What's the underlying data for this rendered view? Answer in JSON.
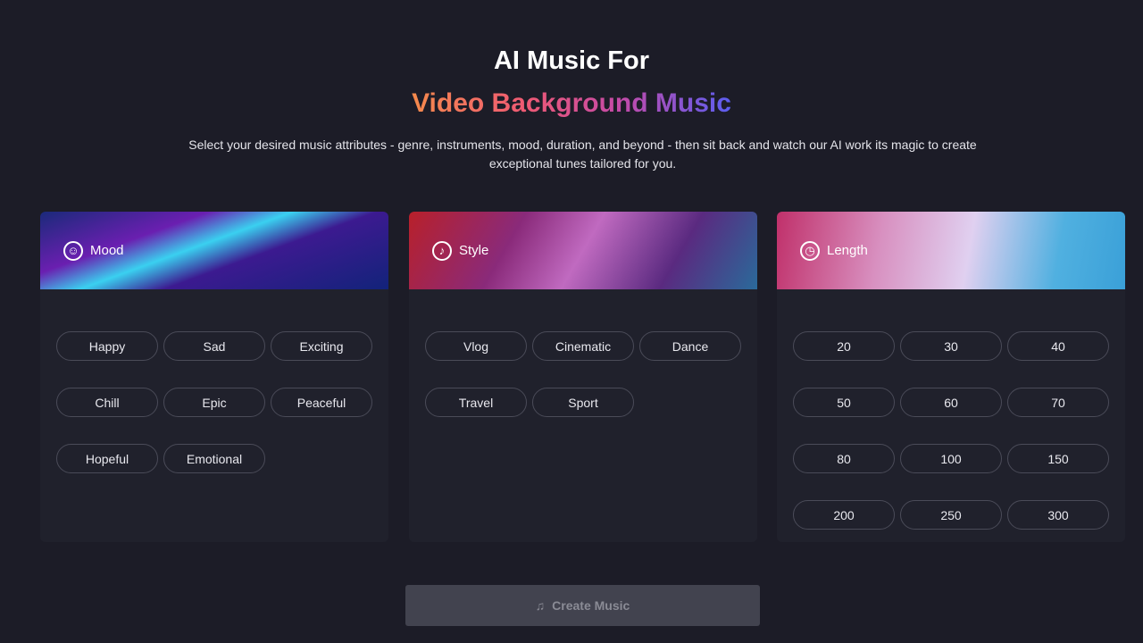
{
  "header": {
    "title": "AI Music For",
    "subtitle": "Video Background Music",
    "description": "Select your desired music attributes - genre, instruments, mood, duration, and beyond - then sit back and watch our AI work its magic to create exceptional tunes tailored for you."
  },
  "cards": [
    {
      "title": "Mood",
      "icon": "mood-faces-icon",
      "options": [
        "Happy",
        "Sad",
        "Exciting",
        "Chill",
        "Epic",
        "Peaceful",
        "Hopeful",
        "Emotional"
      ]
    },
    {
      "title": "Style",
      "icon": "music-note-icon",
      "options": [
        "Vlog",
        "Cinematic",
        "Dance",
        "Travel",
        "Sport"
      ]
    },
    {
      "title": "Length",
      "icon": "clock-icon",
      "options": [
        "20",
        "30",
        "40",
        "50",
        "60",
        "70",
        "80",
        "100",
        "150",
        "200",
        "250",
        "300"
      ]
    }
  ],
  "create_button": {
    "label": "Create Music",
    "icon": "music-icon",
    "disabled": true
  }
}
